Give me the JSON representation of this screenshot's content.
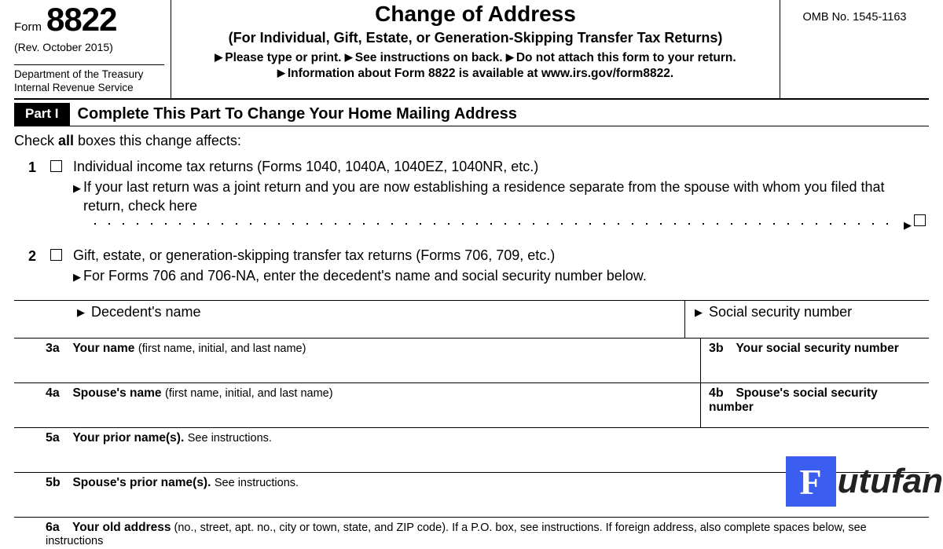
{
  "header": {
    "form_word": "Form",
    "form_number": "8822",
    "revision": "(Rev. October 2015)",
    "dept_line1": "Department of the Treasury",
    "dept_line2": "Internal Revenue Service",
    "title": "Change of Address",
    "subtitle": "(For Individual, Gift, Estate, or Generation-Skipping Transfer Tax Returns)",
    "instr1": "Please type or print.",
    "instr2": "See instructions on back.",
    "instr3": "Do not attach this form to your return.",
    "instr4": "Information about Form 8822 is available at www.irs.gov/form8822.",
    "omb": "OMB No. 1545-1163"
  },
  "part": {
    "badge": "Part I",
    "title": "Complete This Part To Change Your Home Mailing Address"
  },
  "check_instr": "Check all boxes this change affects:",
  "item1": {
    "num": "1",
    "label": "Individual income tax returns (Forms 1040, 1040A, 1040EZ, 1040NR, etc.)",
    "sub": "If your last return was a joint return and you are now establishing a residence separate from the spouse with whom you filed that return, check here"
  },
  "item2": {
    "num": "2",
    "label": "Gift, estate, or generation-skipping transfer tax returns (Forms 706, 709, etc.)",
    "sub": "For Forms 706 and 706-NA, enter the decedent's name and social security number below."
  },
  "decedent": {
    "name_label": "Decedent's name",
    "ssn_label": "Social security number"
  },
  "f3a": {
    "num": "3a",
    "label": "Your name",
    "hint": "(first name, initial, and last name)"
  },
  "f3b": {
    "num": "3b",
    "label": "Your social security number"
  },
  "f4a": {
    "num": "4a",
    "label": "Spouse's name",
    "hint": "(first name, initial, and last name)"
  },
  "f4b": {
    "num": "4b",
    "label": "Spouse's social security number"
  },
  "f5a": {
    "num": "5a",
    "label": "Your prior name(s).",
    "hint": "See instructions."
  },
  "f5b": {
    "num": "5b",
    "label": "Spouse's prior name(s).",
    "hint": "See instructions."
  },
  "f6a": {
    "num": "6a",
    "label": "Your old address",
    "hint": "(no., street, apt. no., city or town, state, and ZIP code). If a P.O. box, see instructions. If foreign address, also complete spaces below, see instructions"
  },
  "watermark": {
    "letter": "F",
    "rest": "utufan"
  }
}
